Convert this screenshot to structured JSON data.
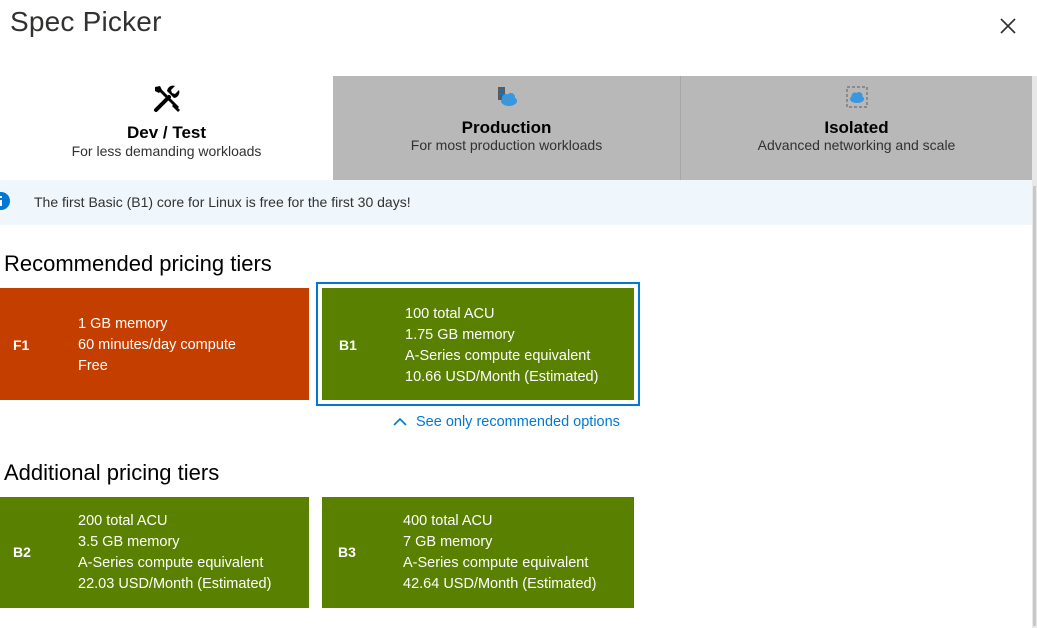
{
  "dialog": {
    "title": "Spec Picker"
  },
  "tabs": [
    {
      "name": "Dev / Test",
      "description": "For less demanding workloads",
      "icon": "tools-icon",
      "active": true
    },
    {
      "name": "Production",
      "description": "For most production workloads",
      "icon": "app-service-plan-icon",
      "active": false
    },
    {
      "name": "Isolated",
      "description": "Advanced networking and scale",
      "icon": "isolated-environment-icon",
      "active": false
    }
  ],
  "info": {
    "icon": "info-icon",
    "text": "The first Basic (B1) core for Linux is free for the first 30 days!"
  },
  "recommended": {
    "heading": "Recommended pricing tiers",
    "cards": [
      {
        "tier": "F1",
        "specs": [
          "1 GB memory",
          "60 minutes/day compute",
          "Free"
        ],
        "color": "#c43e00",
        "selected": false
      },
      {
        "tier": "B1",
        "specs": [
          "100 total ACU",
          "1.75 GB memory",
          "A-Series compute equivalent",
          "10.66 USD/Month (Estimated)"
        ],
        "color": "#5a8000",
        "selected": true
      }
    ],
    "toggle_link": "See only recommended options"
  },
  "additional": {
    "heading": "Additional pricing tiers",
    "cards": [
      {
        "tier": "B2",
        "specs": [
          "200 total ACU",
          "3.5 GB memory",
          "A-Series compute equivalent",
          "22.03 USD/Month (Estimated)"
        ],
        "color": "#5a8000"
      },
      {
        "tier": "B3",
        "specs": [
          "400 total ACU",
          "7 GB memory",
          "A-Series compute equivalent",
          "42.64 USD/Month (Estimated)"
        ],
        "color": "#5a8000"
      }
    ]
  },
  "colors": {
    "accent": "#0078d4",
    "info_background": "#eff6fc",
    "inactive_tab": "#b8b8b8"
  }
}
